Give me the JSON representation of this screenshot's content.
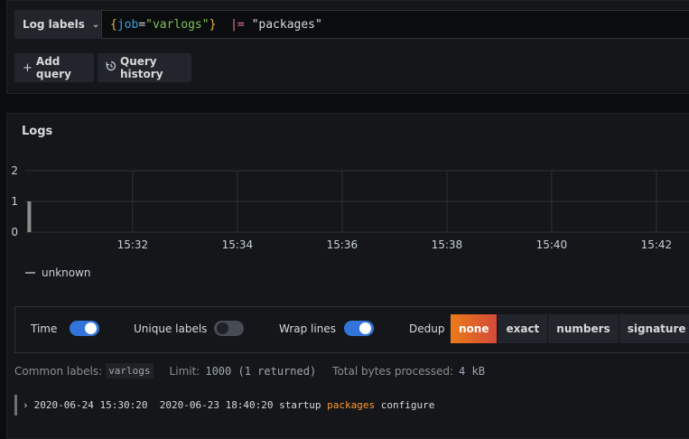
{
  "query_editor": {
    "label_button": "Log labels",
    "query": {
      "open_brace": "{",
      "label_key": "job",
      "equals": "=",
      "label_value": "\"varlogs\"",
      "close_brace": "}",
      "pipe_op": "|=",
      "filter": "\"packages\""
    },
    "add_query": "Add query",
    "query_history": "Query history"
  },
  "logs": {
    "title": "Logs",
    "legend": "unknown",
    "options": {
      "time_label": "Time",
      "time_on": true,
      "unique_labels_label": "Unique labels",
      "unique_labels_on": false,
      "wrap_lines_label": "Wrap lines",
      "wrap_lines_on": true,
      "dedup_label": "Dedup",
      "dedup_options": [
        "none",
        "exact",
        "numbers",
        "signature"
      ],
      "dedup_selected": "none"
    },
    "meta": {
      "common_labels_label": "Common labels:",
      "common_labels_value": "varlogs",
      "limit_label": "Limit:",
      "limit_value": "1000 (1 returned)",
      "bytes_label": "Total bytes processed:",
      "bytes_value": "4 kB"
    },
    "rows": [
      {
        "expand": "›",
        "timestamp": "2020-06-24 15:30:20",
        "line_prefix": "2020-06-23 18:40:20 startup ",
        "highlight": "packages",
        "line_suffix": " configure"
      }
    ]
  },
  "colors": {
    "accent_blue": "#3274d9",
    "dedup_active": "#eb7b18",
    "highlight": "#ff9830",
    "background": "#0b0c0e",
    "panel": "#141619"
  },
  "chart_data": {
    "type": "bar",
    "x_ticks": [
      "15:32",
      "15:34",
      "15:36",
      "15:38",
      "15:40",
      "15:42"
    ],
    "y_ticks": [
      "2",
      "1",
      "0"
    ],
    "ylim": [
      0,
      2
    ],
    "series": [
      {
        "name": "unknown",
        "x": [
          "15:30"
        ],
        "values": [
          1
        ],
        "color": "#8e8e8e"
      }
    ],
    "legend": "bottom-left",
    "grid": true
  }
}
